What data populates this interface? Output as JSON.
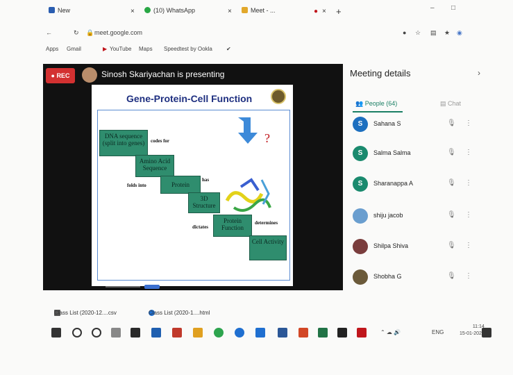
{
  "browser": {
    "tabs": [
      {
        "label": "New",
        "color": "#2a5db0"
      },
      {
        "label": "(10) WhatsApp",
        "color": "#29a745"
      },
      {
        "label": "Meet - ...",
        "color": "#e2a82b"
      }
    ],
    "address": "meet.google.com",
    "bookmarks": [
      "Apps",
      "Gmail",
      "YouTube",
      "Maps",
      "Speedtest by Ookla"
    ]
  },
  "meeting": {
    "rec_label": "REC",
    "presenter_text": "Sinosh Skariyachan is presenting"
  },
  "slide": {
    "title": "Gene-Protein-Cell Function",
    "steps": [
      "DNA sequence (split into genes)",
      "Amino Acid Sequence",
      "Protein",
      "3D Structure",
      "Protein Function",
      "Cell Activity"
    ],
    "connectors": [
      "codes for",
      "folds into",
      "has",
      "dictates",
      "determines"
    ],
    "question_mark": "?"
  },
  "panel": {
    "title": "Meeting details",
    "tab_people": "People (64)",
    "tab_chat": "Chat",
    "people": [
      {
        "name": "Sahana S",
        "initial": "S",
        "color": "#1d6fbf"
      },
      {
        "name": "Salma Salma",
        "initial": "S",
        "color": "#1a8a6e"
      },
      {
        "name": "Sharanappa A",
        "initial": "S",
        "color": "#1a8a6e"
      },
      {
        "name": "shiju jacob",
        "initial": "",
        "color": "#6a9ecf"
      },
      {
        "name": "Shilpa Shiva",
        "initial": "",
        "color": "#7a3d3d"
      },
      {
        "name": "Shobha G",
        "initial": "",
        "color": "#6b5a3a"
      }
    ]
  },
  "downloads": [
    "Class List (2020-12....csv",
    "Class List (2020-1....html"
  ],
  "clock": {
    "time": "11:14",
    "date": "15-01-2021",
    "lang": "ENG"
  }
}
